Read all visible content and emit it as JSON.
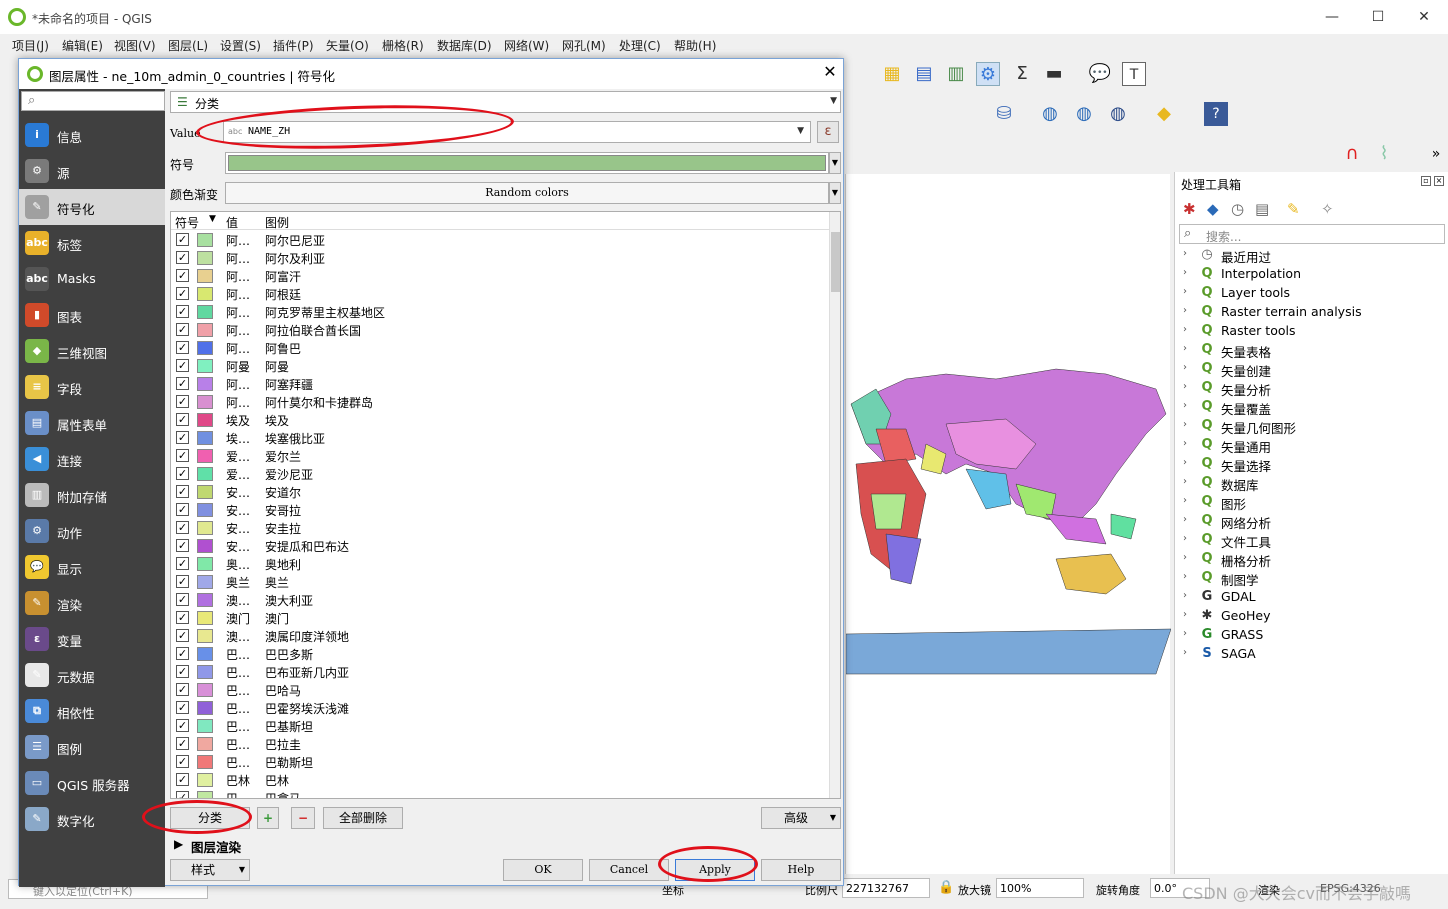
{
  "window": {
    "title": "*未命名的项目 - QGIS",
    "minimize": "—",
    "maximize": "☐",
    "close": "✕"
  },
  "menubar": [
    "项目(J)",
    "编辑(E)",
    "视图(V)",
    "图层(L)",
    "设置(S)",
    "插件(P)",
    "矢量(O)",
    "栅格(R)",
    "数据库(D)",
    "网络(W)",
    "网孔(M)",
    "处理(C)",
    "帮助(H)"
  ],
  "dialog": {
    "title": "图层属性 - ne_10m_admin_0_countries | 符号化",
    "close": "✕",
    "search_icon": "⌕",
    "sidebar": [
      {
        "label": "信息",
        "icon": "info-icon",
        "color": "#2a7ad5",
        "glyph": "i"
      },
      {
        "label": "源",
        "icon": "source-icon",
        "color": "#7a7a7a",
        "glyph": "⚙"
      },
      {
        "label": "符号化",
        "icon": "paint-icon",
        "color": "#a0a0a0",
        "glyph": "✎"
      },
      {
        "label": "标签",
        "icon": "labels-icon",
        "color": "#e8b12a",
        "glyph": "abc"
      },
      {
        "label": "Masks",
        "icon": "masks-icon",
        "color": "#555555",
        "glyph": "abc"
      },
      {
        "label": "图表",
        "icon": "diagram-icon",
        "color": "#d04a2a",
        "glyph": "▮"
      },
      {
        "label": "三维视图",
        "icon": "cube-icon",
        "color": "#7ab648",
        "glyph": "◆"
      },
      {
        "label": "字段",
        "icon": "fields-icon",
        "color": "#e8c547",
        "glyph": "≡"
      },
      {
        "label": "属性表单",
        "icon": "form-icon",
        "color": "#6a8fc8",
        "glyph": "▤"
      },
      {
        "label": "连接",
        "icon": "join-icon",
        "color": "#3a8fd8",
        "glyph": "◀"
      },
      {
        "label": "附加存储",
        "icon": "storage-icon",
        "color": "#bbbbbb",
        "glyph": "▥"
      },
      {
        "label": "动作",
        "icon": "action-icon",
        "color": "#5a7aa8",
        "glyph": "⚙"
      },
      {
        "label": "显示",
        "icon": "display-icon",
        "color": "#f0c830",
        "glyph": "💬"
      },
      {
        "label": "渲染",
        "icon": "render-icon",
        "color": "#c89030",
        "glyph": "✎"
      },
      {
        "label": "变量",
        "icon": "variable-icon",
        "color": "#6a4a8a",
        "glyph": "ε"
      },
      {
        "label": "元数据",
        "icon": "metadata-icon",
        "color": "#e8e8e8",
        "glyph": "✎"
      },
      {
        "label": "相依性",
        "icon": "dependency-icon",
        "color": "#4a8ad8",
        "glyph": "⧉"
      },
      {
        "label": "图例",
        "icon": "legend-icon",
        "color": "#7a9ac8",
        "glyph": "☰"
      },
      {
        "label": "QGIS 服务器",
        "icon": "server-icon",
        "color": "#6a8ab8",
        "glyph": "▭"
      },
      {
        "label": "数字化",
        "icon": "digitize-icon",
        "color": "#8aa8c8",
        "glyph": "✎"
      }
    ],
    "renderer": "分类",
    "value_label": "Value",
    "value_field": "NAME_ZH",
    "value_prefix": "abc",
    "expression_btn": "ε",
    "symbol_label": "符号",
    "symbol_color": "#98c58a",
    "ramp_label": "颜色渐变",
    "ramp_value": "Random colors",
    "headers": {
      "symbol": "符号",
      "value": "值",
      "legend": "图例"
    },
    "classes": [
      {
        "value": "阿…",
        "legend": "阿尔巴尼亚",
        "color": "#a8e0a0"
      },
      {
        "value": "阿…",
        "legend": "阿尔及利亚",
        "color": "#bde0a0"
      },
      {
        "value": "阿…",
        "legend": "阿富汗",
        "color": "#e8d090"
      },
      {
        "value": "阿…",
        "legend": "阿根廷",
        "color": "#d8e870"
      },
      {
        "value": "阿…",
        "legend": "阿克罗蒂里主权基地区",
        "color": "#60d8a0"
      },
      {
        "value": "阿…",
        "legend": "阿拉伯联合酋长国",
        "color": "#f0a0a8"
      },
      {
        "value": "阿…",
        "legend": "阿鲁巴",
        "color": "#5070e8"
      },
      {
        "value": "阿曼",
        "legend": "阿曼",
        "color": "#80f0c0"
      },
      {
        "value": "阿…",
        "legend": "阿塞拜疆",
        "color": "#b880e8"
      },
      {
        "value": "阿…",
        "legend": "阿什莫尔和卡捷群岛",
        "color": "#d890d0"
      },
      {
        "value": "埃及",
        "legend": "埃及",
        "color": "#e04888"
      },
      {
        "value": "埃…",
        "legend": "埃塞俄比亚",
        "color": "#7090e0"
      },
      {
        "value": "爱…",
        "legend": "爱尔兰",
        "color": "#f060b0"
      },
      {
        "value": "爱…",
        "legend": "爱沙尼亚",
        "color": "#60e0a8"
      },
      {
        "value": "安…",
        "legend": "安道尔",
        "color": "#c0d870"
      },
      {
        "value": "安…",
        "legend": "安哥拉",
        "color": "#8090e0"
      },
      {
        "value": "安…",
        "legend": "安圭拉",
        "color": "#e0e890"
      },
      {
        "value": "安…",
        "legend": "安提瓜和巴布达",
        "color": "#b050d0"
      },
      {
        "value": "奥…",
        "legend": "奥地利",
        "color": "#80e8a8"
      },
      {
        "value": "奥兰",
        "legend": "奥兰",
        "color": "#a0a8e8"
      },
      {
        "value": "澳…",
        "legend": "澳大利亚",
        "color": "#b070e0"
      },
      {
        "value": "澳门",
        "legend": "澳门",
        "color": "#e8e878"
      },
      {
        "value": "澳…",
        "legend": "澳属印度洋领地",
        "color": "#e8e890"
      },
      {
        "value": "巴…",
        "legend": "巴巴多斯",
        "color": "#6890e8"
      },
      {
        "value": "巴…",
        "legend": "巴布亚新几内亚",
        "color": "#9098e8"
      },
      {
        "value": "巴…",
        "legend": "巴哈马",
        "color": "#d890d8"
      },
      {
        "value": "巴…",
        "legend": "巴霍努埃沃浅滩",
        "color": "#9060d8"
      },
      {
        "value": "巴…",
        "legend": "巴基斯坦",
        "color": "#80e8c0"
      },
      {
        "value": "巴…",
        "legend": "巴拉圭",
        "color": "#f0a8a0"
      },
      {
        "value": "巴…",
        "legend": "巴勒斯坦",
        "color": "#f07878"
      },
      {
        "value": "巴林",
        "legend": "巴林",
        "color": "#e0f0a0"
      },
      {
        "value": "巴…",
        "legend": "巴拿马",
        "color": "#c0e8a0"
      }
    ],
    "btn_classify": "分类",
    "btn_add": "+",
    "btn_remove": "−",
    "btn_delete_all": "全部删除",
    "btn_advanced": "高级",
    "layer_rendering": "图层渲染",
    "btn_style": "样式",
    "btn_ok": "OK",
    "btn_cancel": "Cancel",
    "btn_apply": "Apply",
    "btn_help": "Help"
  },
  "toolbox": {
    "title": "处理工具箱",
    "search_placeholder": "搜索...",
    "items": [
      {
        "label": "最近用过",
        "icon": "clock-icon",
        "glyph": "◷",
        "color": "#666666"
      },
      {
        "label": "Interpolation",
        "icon": "qgis-icon",
        "glyph": "Q",
        "color": "#5a9b2a"
      },
      {
        "label": "Layer tools",
        "icon": "qgis-icon",
        "glyph": "Q",
        "color": "#5a9b2a"
      },
      {
        "label": "Raster terrain analysis",
        "icon": "qgis-icon",
        "glyph": "Q",
        "color": "#5a9b2a"
      },
      {
        "label": "Raster tools",
        "icon": "qgis-icon",
        "glyph": "Q",
        "color": "#5a9b2a"
      },
      {
        "label": "矢量表格",
        "icon": "qgis-icon",
        "glyph": "Q",
        "color": "#5a9b2a"
      },
      {
        "label": "矢量创建",
        "icon": "qgis-icon",
        "glyph": "Q",
        "color": "#5a9b2a"
      },
      {
        "label": "矢量分析",
        "icon": "qgis-icon",
        "glyph": "Q",
        "color": "#5a9b2a"
      },
      {
        "label": "矢量覆盖",
        "icon": "qgis-icon",
        "glyph": "Q",
        "color": "#5a9b2a"
      },
      {
        "label": "矢量几何图形",
        "icon": "qgis-icon",
        "glyph": "Q",
        "color": "#5a9b2a"
      },
      {
        "label": "矢量通用",
        "icon": "qgis-icon",
        "glyph": "Q",
        "color": "#5a9b2a"
      },
      {
        "label": "矢量选择",
        "icon": "qgis-icon",
        "glyph": "Q",
        "color": "#5a9b2a"
      },
      {
        "label": "数据库",
        "icon": "qgis-icon",
        "glyph": "Q",
        "color": "#5a9b2a"
      },
      {
        "label": "图形",
        "icon": "qgis-icon",
        "glyph": "Q",
        "color": "#5a9b2a"
      },
      {
        "label": "网络分析",
        "icon": "qgis-icon",
        "glyph": "Q",
        "color": "#5a9b2a"
      },
      {
        "label": "文件工具",
        "icon": "qgis-icon",
        "glyph": "Q",
        "color": "#5a9b2a"
      },
      {
        "label": "栅格分析",
        "icon": "qgis-icon",
        "glyph": "Q",
        "color": "#5a9b2a"
      },
      {
        "label": "制图学",
        "icon": "qgis-icon",
        "glyph": "Q",
        "color": "#5a9b2a"
      },
      {
        "label": "GDAL",
        "icon": "gdal-icon",
        "glyph": "G",
        "color": "#333333"
      },
      {
        "label": "GeoHey",
        "icon": "geohey-icon",
        "glyph": "✱",
        "color": "#333333"
      },
      {
        "label": "GRASS",
        "icon": "grass-icon",
        "glyph": "G",
        "color": "#2a8a2a"
      },
      {
        "label": "SAGA",
        "icon": "saga-icon",
        "glyph": "S",
        "color": "#1a5aa8"
      }
    ]
  },
  "status": {
    "locate_placeholder": "键入以定位(Ctrl+K)",
    "coord_label": "坐标",
    "scale_label": "比例尺",
    "scale_value": "227132767",
    "magnifier_label": "放大镜",
    "magnifier_value": "100%",
    "rotation_label": "旋转角度",
    "rotation_value": "0.0°",
    "render_label": "渲染",
    "crs": "EPSG:4326",
    "watermark": "CSDN @大大会cv而不会手敲嗎"
  }
}
